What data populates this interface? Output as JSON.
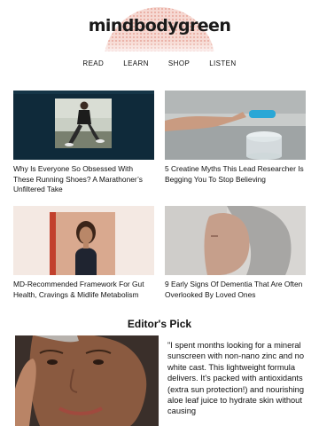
{
  "header": {
    "logo": "mindbodygreen"
  },
  "nav": {
    "items": [
      "READ",
      "LEARN",
      "SHOP",
      "LISTEN"
    ]
  },
  "articles": [
    {
      "title": "Why Is Everyone So Obsessed With These Running Shoes? A Marathoner’s Unfiltered Take"
    },
    {
      "title": "5 Creatine Myths This Lead Researcher Is Begging You To Stop Believing"
    },
    {
      "title": "MD-Recommended Framework For Gut Health, Cravings & Midlife Metabolism"
    },
    {
      "title": "9 Early Signs Of Dementia That Are Often Overlooked By Loved Ones"
    }
  ],
  "editors_pick": {
    "heading": "Editor's Pick",
    "text": "\"I spent months looking for a mineral sunscreen with non-nano zinc and no white cast. This lightweight formula delivers. It's packed with antioxidants (extra sun protection!) and nourishing aloe leaf juice to hydrate skin without causing"
  }
}
